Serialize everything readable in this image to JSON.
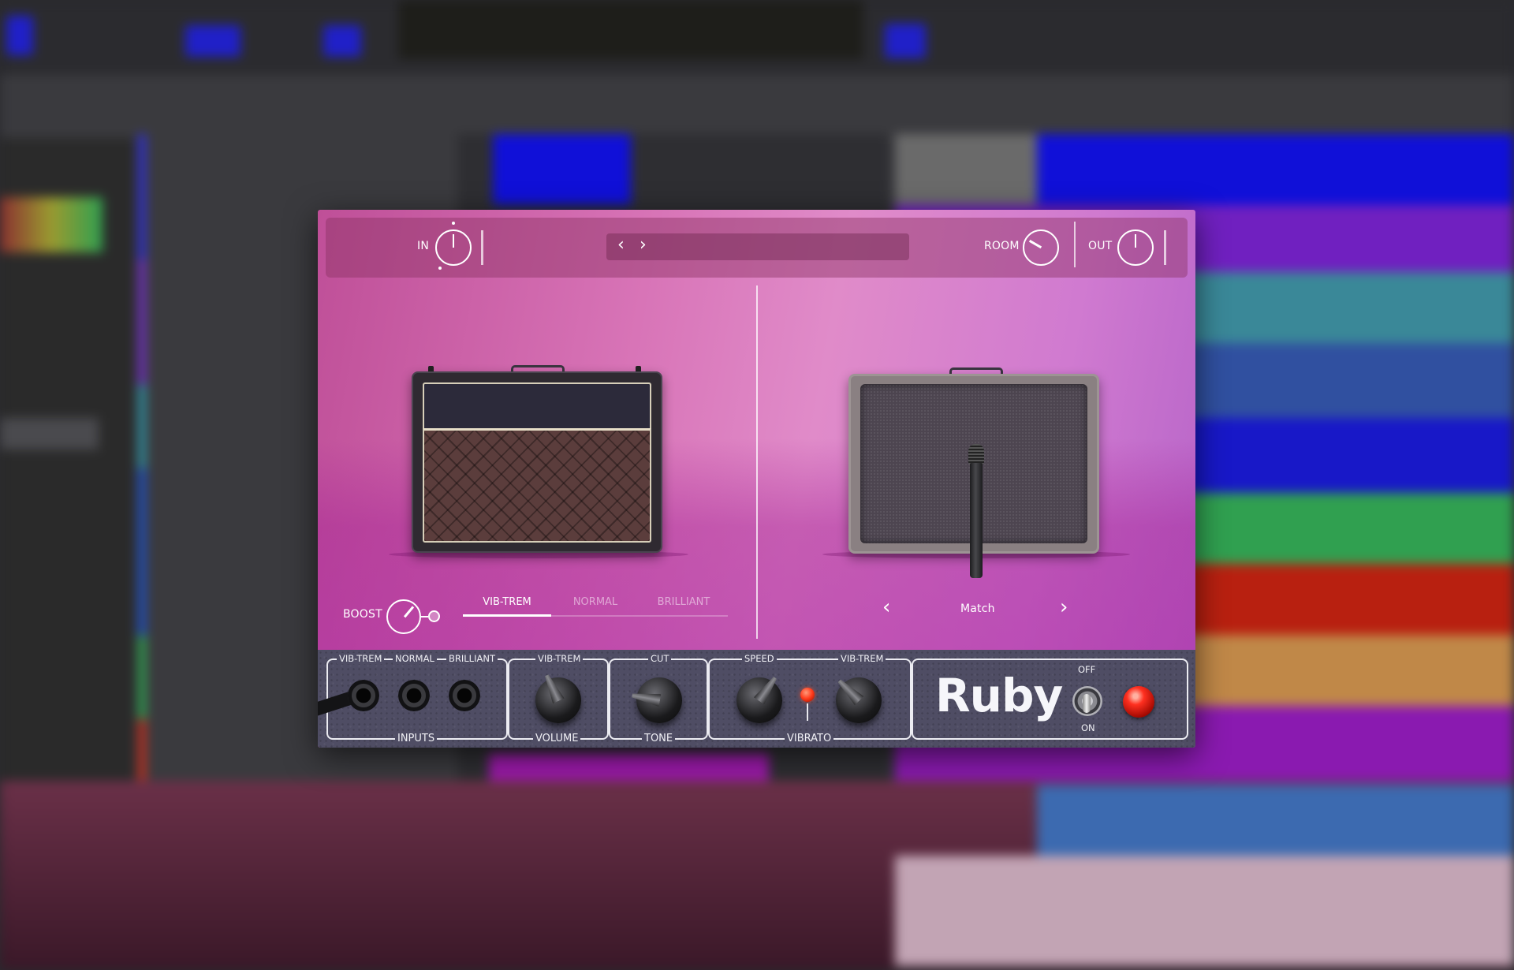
{
  "plugin": {
    "header": {
      "in_label": "IN",
      "room_label": "ROOM",
      "out_label": "OUT",
      "preset_prev_glyph": "‹",
      "preset_next_glyph": "›"
    },
    "amp_section": {
      "boost_label": "BOOST",
      "channel_tabs": [
        {
          "label": "VIB-TREM",
          "active": true
        },
        {
          "label": "NORMAL",
          "active": false
        },
        {
          "label": "BRILLIANT",
          "active": false
        }
      ]
    },
    "cab_section": {
      "mic_position": "Match",
      "prev_glyph": "‹",
      "next_glyph": "›"
    },
    "panel": {
      "inputs": {
        "title": "INPUTS",
        "jacks": [
          "VIB-TREM",
          "NORMAL",
          "BRILLIANT"
        ]
      },
      "volume": {
        "title": "VOLUME",
        "top": "VIB-TREM"
      },
      "tone": {
        "title": "TONE",
        "top": "CUT"
      },
      "vibrato": {
        "title": "VIBRATO",
        "speed": "SPEED",
        "vibtrem": "VIB-TREM"
      },
      "brand": "Ruby",
      "toggle_off": "OFF",
      "toggle_on": "ON"
    },
    "colors": {
      "plugin_pink": "#d874b7",
      "panel": "#4f4d64",
      "led": "#ff3a1a"
    }
  }
}
